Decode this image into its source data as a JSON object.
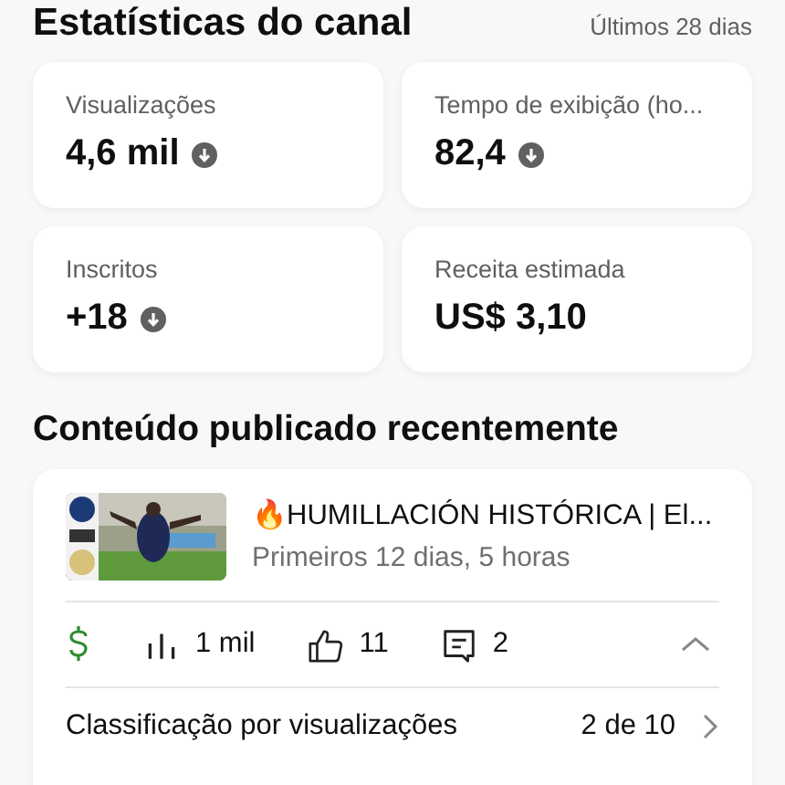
{
  "channel_stats": {
    "title": "Estatísticas do canal",
    "period": "Últimos 28 dias",
    "cards": [
      {
        "label": "Visualizações",
        "value": "4,6 mil",
        "trend_down": true
      },
      {
        "label": "Tempo de exibição (ho...",
        "value": "82,4",
        "trend_down": true
      },
      {
        "label": "Inscritos",
        "value": "+18",
        "trend_down": true
      },
      {
        "label": "Receita estimada",
        "value": "US$ 3,10"
      }
    ]
  },
  "recent": {
    "title": "Conteúdo publicado recentemente",
    "video": {
      "title": "🔥HUMILLACIÓN HISTÓRICA | El...",
      "subtitle": "Primeiros 12 dias, 5 horas",
      "monetized": true,
      "views": "1 mil",
      "likes": "11",
      "comments": "2",
      "expanded": true
    },
    "ranking": {
      "label": "Classificação por visualizações",
      "value": "2 de 10"
    }
  }
}
